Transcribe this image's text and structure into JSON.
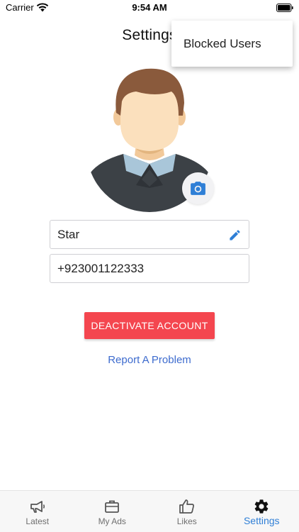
{
  "status_bar": {
    "carrier": "Carrier",
    "time": "9:54 AM"
  },
  "header": {
    "title": "Settings"
  },
  "menu": {
    "items": [
      {
        "label": "Blocked Users"
      }
    ]
  },
  "profile": {
    "name": "Star",
    "phone": "+923001122333"
  },
  "actions": {
    "deactivate_label": "DEACTIVATE ACCOUNT",
    "report_label": "Report A Problem"
  },
  "tabbar": {
    "tabs": [
      {
        "label": "Latest",
        "icon": "megaphone-icon"
      },
      {
        "label": "My Ads",
        "icon": "briefcase-icon"
      },
      {
        "label": "Likes",
        "icon": "thumbs-up-icon"
      },
      {
        "label": "Settings",
        "icon": "gear-icon"
      }
    ],
    "active_index": 3
  },
  "colors": {
    "accent": "#2f7fd6",
    "danger": "#f4464f",
    "link": "#3d6bce"
  }
}
